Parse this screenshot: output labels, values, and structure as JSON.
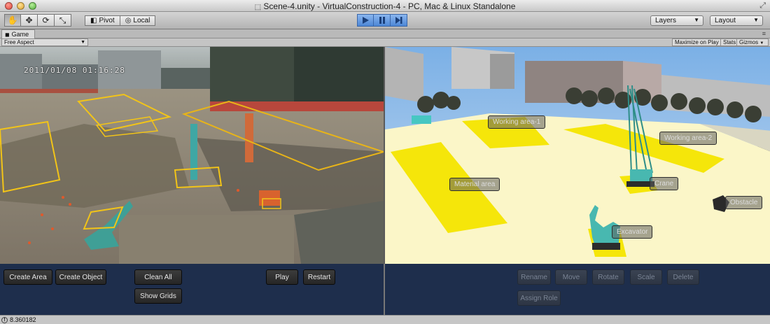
{
  "window": {
    "title": "Scene-4.unity - VirtualConstruction-4 - PC, Mac & Linux Standalone"
  },
  "toolbar": {
    "tools": [
      {
        "name": "hand-icon",
        "glyph": "✋"
      },
      {
        "name": "move-icon",
        "glyph": "✥"
      },
      {
        "name": "rotate-icon",
        "glyph": "⟳"
      },
      {
        "name": "scale-icon",
        "glyph": "⤡"
      }
    ],
    "pivot_label": "Pivot",
    "local_label": "Local",
    "layers_label": "Layers",
    "layout_label": "Layout"
  },
  "tab": {
    "label": "Game"
  },
  "gamebar": {
    "aspect": "Free Aspect",
    "maximize_on_play": "Maximize on Play",
    "stats": "Stats",
    "gizmos": "Gizmos"
  },
  "camera": {
    "timestamp": "2011/01/08 01:16:28"
  },
  "scene": {
    "labels": {
      "working_area_1": "Working area-1",
      "working_area_2": "Working area-2",
      "material_area": "Material area",
      "crane": "Crane",
      "obstacle": "Obstacle",
      "excavator": "Excavator"
    }
  },
  "controls_left": {
    "create_area": "Create Area",
    "create_object": "Create Object",
    "clean_all": "Clean All",
    "show_grids": "Show Grids",
    "play": "Play",
    "restart": "Restart"
  },
  "controls_right": {
    "rename": "Rename",
    "move": "Move",
    "rotate": "Rotate",
    "scale": "Scale",
    "delete": "Delete",
    "assign_role": "Assign Role"
  },
  "status": {
    "message": "8.360182"
  },
  "colors": {
    "accent_blue": "#4c86d6",
    "zone_yellow": "#f5e60a",
    "ground_cream": "#fbf6c8",
    "panel_navy": "#1e2e4c"
  }
}
